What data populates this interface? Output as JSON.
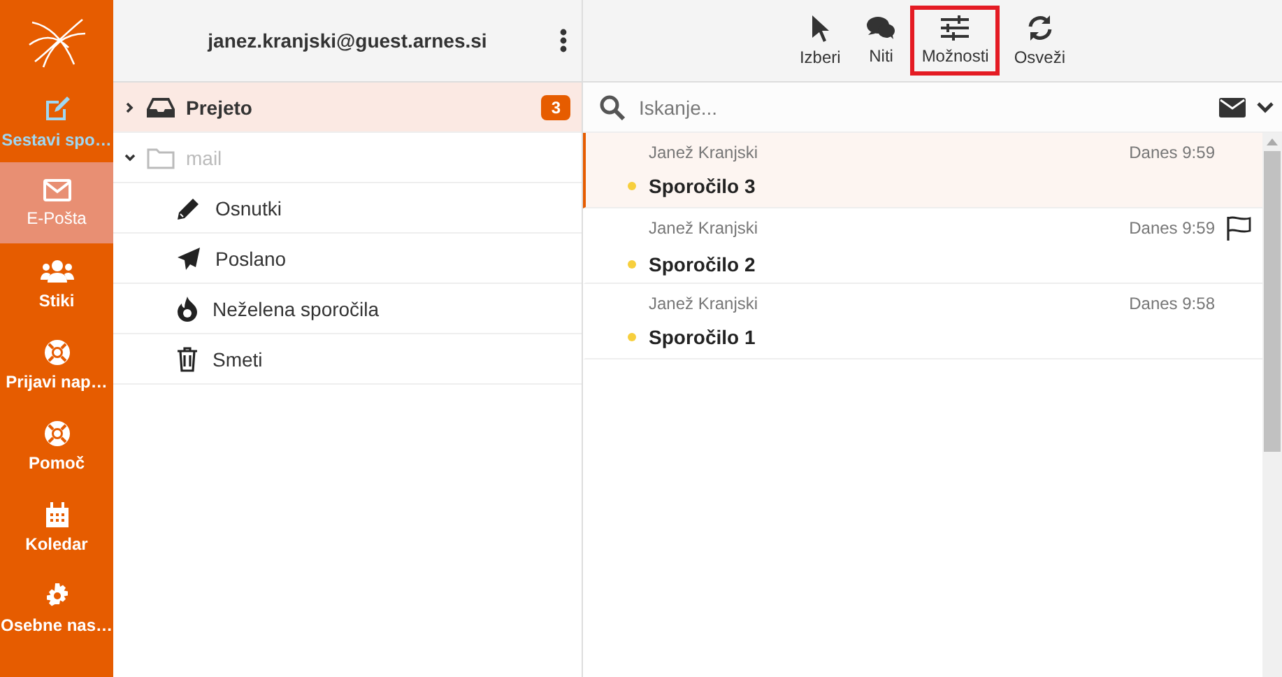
{
  "nav": [
    {
      "label": "Sestavi spo…",
      "kind": "compose",
      "selected": false,
      "hover": true
    },
    {
      "label": "E-Pošta",
      "kind": "mail",
      "selected": true,
      "hover": false
    },
    {
      "label": "Stiki",
      "kind": "people",
      "selected": false,
      "hover": false
    },
    {
      "label": "Prijavi nap…",
      "kind": "lifering",
      "selected": false,
      "hover": false
    },
    {
      "label": "Pomoč",
      "kind": "lifering",
      "selected": false,
      "hover": false
    },
    {
      "label": "Koledar",
      "kind": "calendar",
      "selected": false,
      "hover": false
    },
    {
      "label": "Osebne nas…",
      "kind": "gear",
      "selected": false,
      "hover": false
    }
  ],
  "account": "janez.kranjski@guest.arnes.si",
  "folders": [
    {
      "name": "Prejeto",
      "kind": "inbox",
      "selected": true,
      "expanded": false,
      "disabled": false,
      "unread": "3"
    },
    {
      "name": "mail",
      "kind": "folder",
      "selected": false,
      "expanded": true,
      "disabled": true,
      "children": [
        {
          "name": "Osnutki",
          "kind": "pencil",
          "selected": false
        },
        {
          "name": "Poslano",
          "kind": "plane",
          "selected": false
        },
        {
          "name": "Neželena sporočila",
          "kind": "fire",
          "selected": false
        },
        {
          "name": "Smeti",
          "kind": "trash",
          "selected": false
        }
      ]
    }
  ],
  "toolbar": [
    {
      "label": "Izberi",
      "kind": "pointer",
      "highlighted": false
    },
    {
      "label": "Niti",
      "kind": "chat",
      "highlighted": false
    },
    {
      "label": "Možnosti",
      "kind": "sliders",
      "highlighted": true
    },
    {
      "label": "Osveži",
      "kind": "refresh",
      "highlighted": false
    }
  ],
  "search": {
    "placeholder": "Iskanje..."
  },
  "messages": [
    {
      "sender": "Janež Kranjski",
      "date": "Danes 9:59",
      "subject": "Sporočilo 3",
      "unread": true,
      "flagged": false,
      "selected": true
    },
    {
      "sender": "Janež Kranjski",
      "date": "Danes 9:59",
      "subject": "Sporočilo 2",
      "unread": true,
      "flagged": true,
      "selected": false
    },
    {
      "sender": "Janež Kranjski",
      "date": "Danes 9:58",
      "subject": "Sporočilo 1",
      "unread": true,
      "flagged": false,
      "selected": false
    }
  ]
}
